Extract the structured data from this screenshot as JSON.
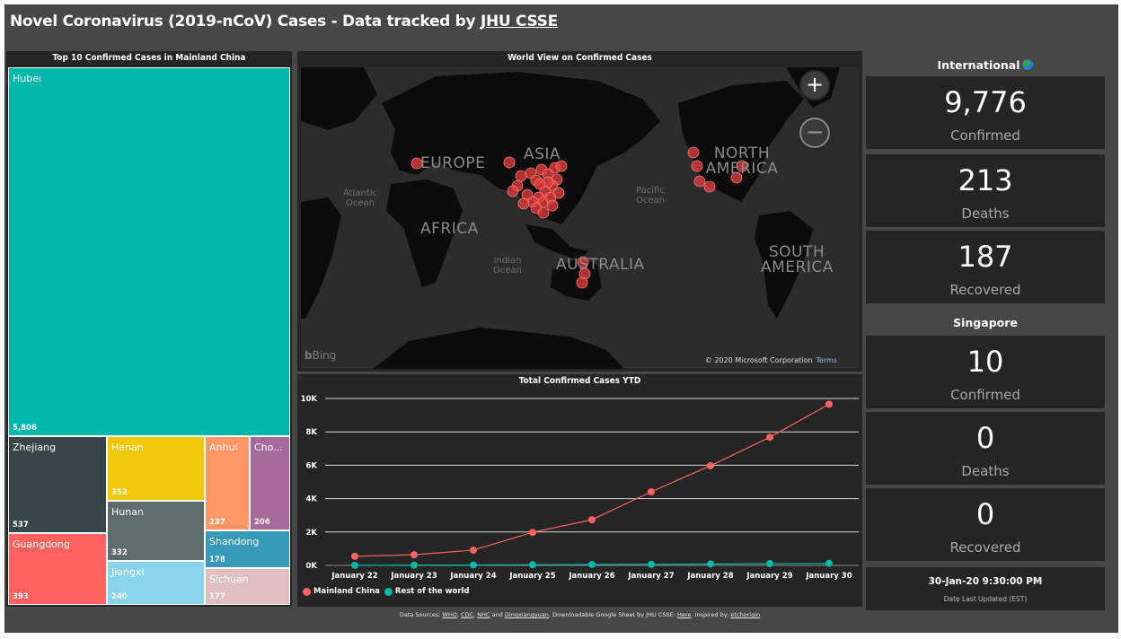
{
  "header": {
    "title_prefix": "Novel Coronavirus (2019-nCoV) Cases - Data tracked by ",
    "title_link": "JHU CSSE"
  },
  "treemap": {
    "title": "Top 10 Confirmed Cases in Mainland China",
    "tiles": [
      {
        "name": "Hubei",
        "value": "5,806",
        "color": "#01B8AA"
      },
      {
        "name": "Zhejiang",
        "value": "537",
        "color": "#374649"
      },
      {
        "name": "Guangdong",
        "value": "393",
        "color": "#FD625E"
      },
      {
        "name": "Henan",
        "value": "352",
        "color": "#F2C80F"
      },
      {
        "name": "Hunan",
        "value": "332",
        "color": "#5F6B6D"
      },
      {
        "name": "Jiangxi",
        "value": "240",
        "color": "#8AD4EB"
      },
      {
        "name": "Anhui",
        "value": "237",
        "color": "#FE9666"
      },
      {
        "name": "Cho...",
        "value": "206",
        "color": "#A66999"
      },
      {
        "name": "Shandong",
        "value": "178",
        "color": "#3599B8"
      },
      {
        "name": "Sichuan",
        "value": "177",
        "color": "#DFBFBF"
      }
    ]
  },
  "map": {
    "title": "World View on Confirmed Cases",
    "continent_labels": [
      "EUROPE",
      "ASIA",
      "NORTH AMERICA",
      "AFRICA",
      "AUSTRALIA",
      "SOUTH AMERICA"
    ],
    "ocean_labels": [
      "Atlantic Ocean",
      "Pacific Ocean",
      "Indian Ocean"
    ],
    "zoom_in_label": "+",
    "zoom_out_label": "−",
    "bing_label": "Bing",
    "copyright": "© 2020 Microsoft Corporation",
    "terms": "Terms",
    "marker_color": "#E8423F"
  },
  "chart_data": {
    "type": "line",
    "title": "Total Confirmed Cases YTD",
    "xlabel": "",
    "ylabel": "",
    "categories": [
      "January 22",
      "January 23",
      "January 24",
      "January 25",
      "January 26",
      "January 27",
      "January 28",
      "January 29",
      "January 30"
    ],
    "series": [
      {
        "name": "Mainland China",
        "color": "#FD625E",
        "values": [
          547,
          639,
          916,
          1979,
          2737,
          4409,
          5970,
          7678,
          9658
        ]
      },
      {
        "name": "Rest of the world",
        "color": "#01B8AA",
        "values": [
          8,
          14,
          25,
          40,
          57,
          64,
          87,
          105,
          118
        ]
      }
    ],
    "yticks": [
      "0K",
      "2K",
      "4K",
      "6K",
      "8K",
      "10K"
    ],
    "ylim": [
      0,
      10000
    ],
    "grid": true,
    "legend": "bottom-left"
  },
  "international": {
    "title": "International",
    "icon": "globe-icon",
    "confirmed": "9,776",
    "confirmed_label": "Confirmed",
    "deaths": "213",
    "deaths_label": "Deaths",
    "recovered": "187",
    "recovered_label": "Recovered"
  },
  "singapore": {
    "title": "Singapore",
    "confirmed": "10",
    "confirmed_label": "Confirmed",
    "deaths": "0",
    "deaths_label": "Deaths",
    "recovered": "0",
    "recovered_label": "Recovered"
  },
  "updated": {
    "datetime": "30-Jan-20 9:30:00 PM",
    "label": "Date Last Updated (EST)"
  },
  "footer": {
    "prefix": "Data Sources: ",
    "links": [
      "WHO",
      "CDC",
      "NHC",
      "Dingxiangyuan"
    ],
    "sep1": ", ",
    "and": " and ",
    "sheet_text": ".  Downloadable Google Sheet by JHU CSSE: ",
    "here": "Here",
    "inspired": ".  Inspired by: ",
    "inspired_link": "etchorigin"
  }
}
